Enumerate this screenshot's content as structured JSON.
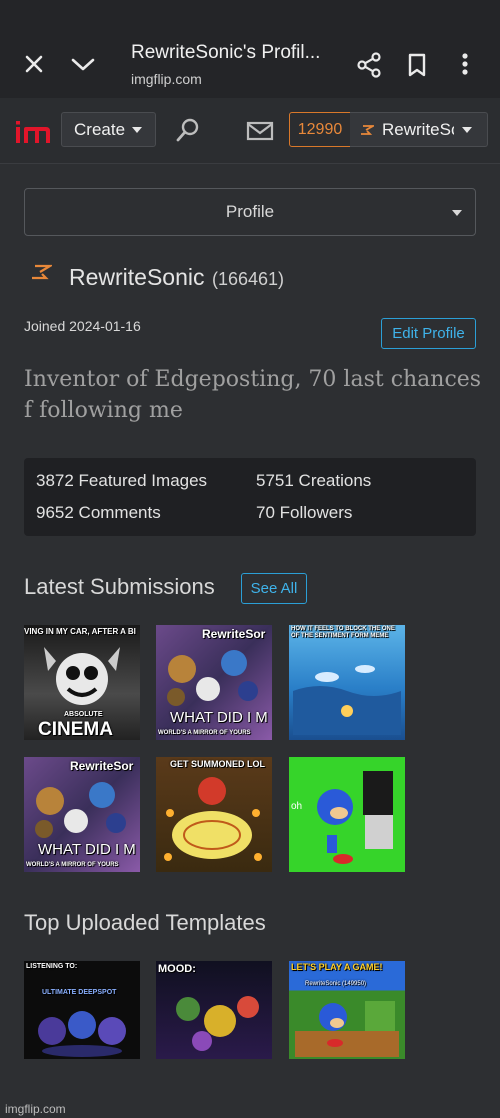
{
  "browser": {
    "page_title": "RewriteSonic's Profil...",
    "url": "imgflip.com",
    "icons": [
      "close-icon",
      "chevron-down-icon",
      "share-icon",
      "bookmark-icon",
      "more-vert-icon"
    ]
  },
  "nav": {
    "create_label": "Create",
    "points": "12990",
    "username_short": "RewriteSonic",
    "icons": [
      "imgflip-logo",
      "search-icon",
      "mail-icon"
    ]
  },
  "profile": {
    "select_label": "Profile",
    "username": "RewriteSonic",
    "score": "(166461)",
    "joined": "Joined 2024-01-16",
    "edit_label": "Edit Profile",
    "bio": "Inventor of Edgeposting, 70 last chances f following me",
    "stats": {
      "featured": "3872 Featured Images",
      "creations": "5751 Creations",
      "comments": "9652 Comments",
      "followers": "70 Followers"
    }
  },
  "latest": {
    "title": "Latest Submissions",
    "see_all": "See All",
    "items": [
      {
        "top_text": "VING IN MY CAR, AFTER A BI",
        "small": "ABSOLUTE",
        "big": "CINEMA"
      },
      {
        "top_text": "RewriteSor",
        "bottom_text": "WHAT DID I M",
        "footer": "WORLD'S A MIRROR OF YOURS"
      },
      {
        "top_text": "HOW IT FEELS TO BLOCK THE ONE OF THE SENTIMENT FORM MEME"
      },
      {
        "top_text": "RewriteSor",
        "bottom_text": "WHAT DID I M",
        "footer": "WORLD'S A MIRROR OF YOURS"
      },
      {
        "top_text": "GET SUMMONED LOL"
      },
      {
        "top_text": "oh"
      }
    ]
  },
  "templates": {
    "title": "Top Uploaded Templates",
    "items": [
      {
        "top_text": "LISTENING TO:",
        "sub": "ULTIMATE DEEPSPOT"
      },
      {
        "top_text": "MOOD:"
      },
      {
        "top_text": "LET'S PLAY A GAME!",
        "sub": "RewriteSonic (149950)"
      }
    ]
  },
  "footer": {
    "watermark": "imgflip.com"
  },
  "colors": {
    "accent_blue": "#2b9fd6",
    "points_orange": "#e8883a",
    "logo_red": "#e2152a"
  }
}
